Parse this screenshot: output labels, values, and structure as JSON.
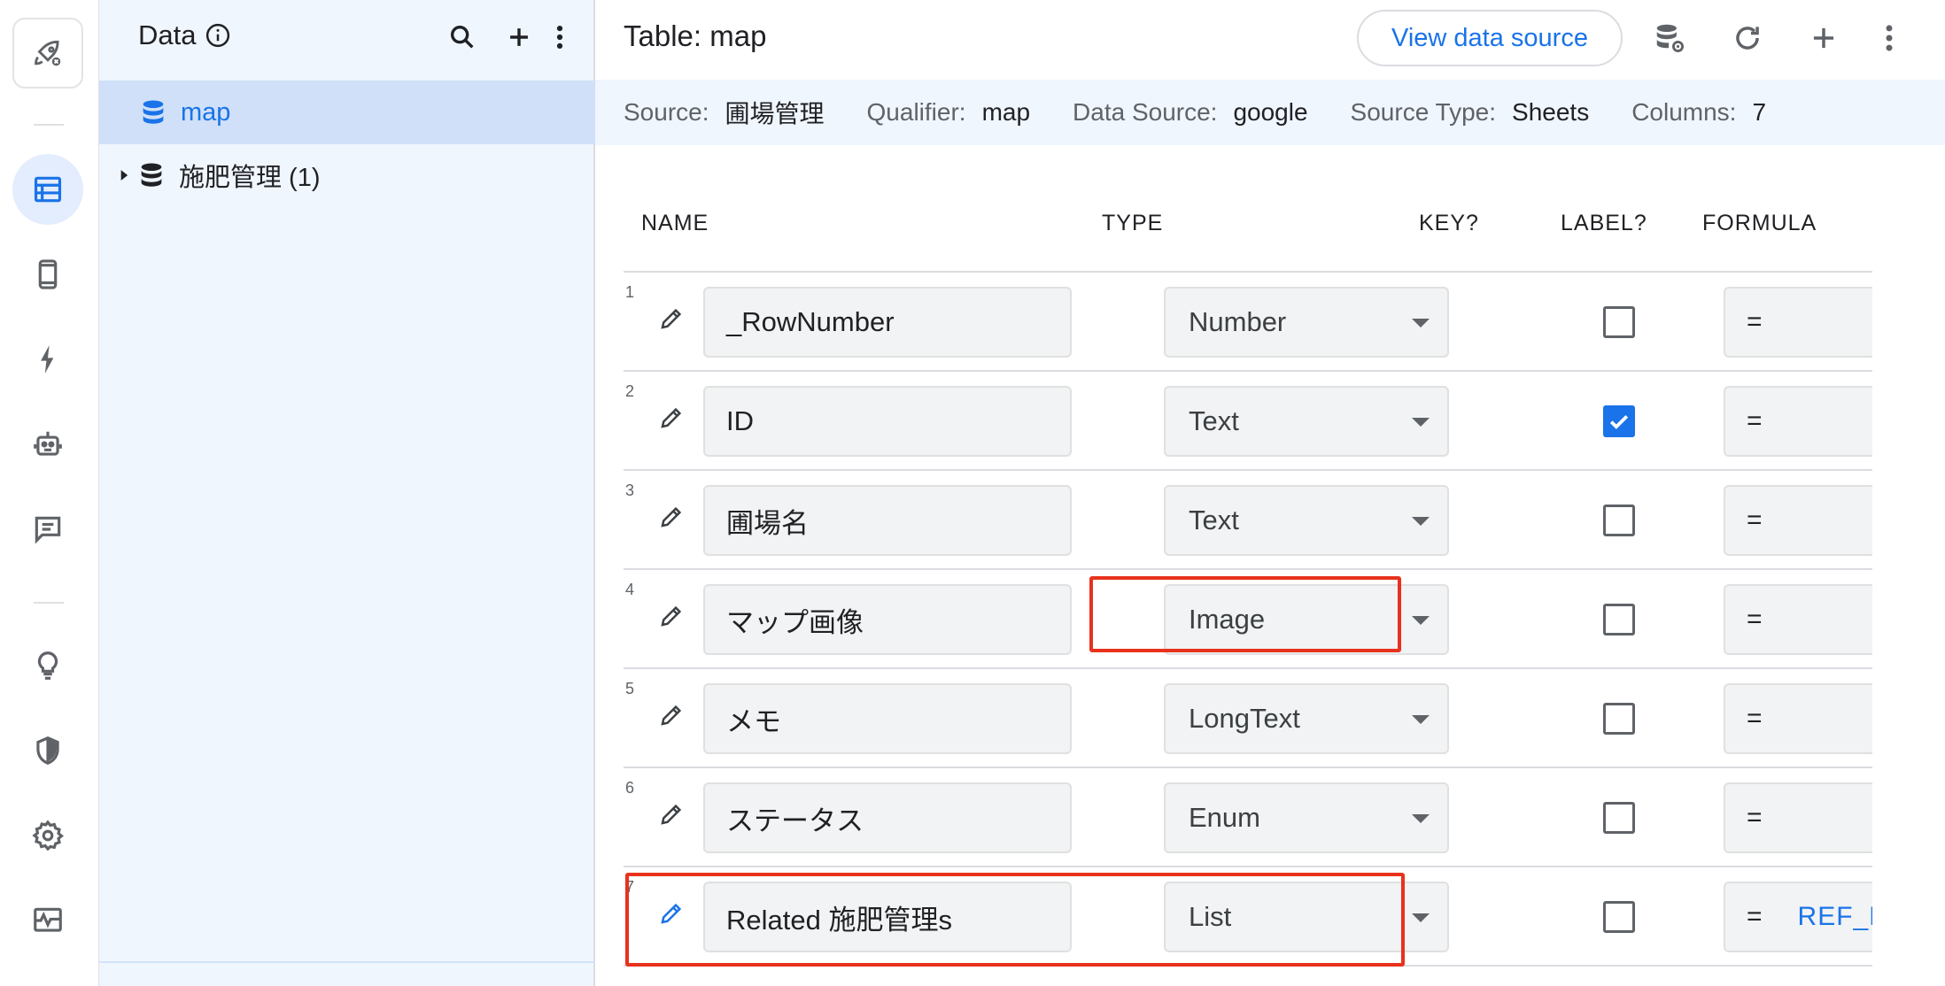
{
  "data_panel": {
    "title": "Data",
    "tables": [
      {
        "label": "map",
        "selected": true
      },
      {
        "label": "施肥管理 (1)",
        "selected": false
      }
    ]
  },
  "header": {
    "title": "Table: map",
    "view_source_label": "View data source"
  },
  "info": {
    "source_label": "Source:",
    "source_value": "圃場管理",
    "qualifier_label": "Qualifier:",
    "qualifier_value": "map",
    "data_source_label": "Data Source:",
    "data_source_value": "google",
    "source_type_label": "Source Type:",
    "source_type_value": "Sheets",
    "columns_label": "Columns:",
    "columns_value": "7"
  },
  "columns": {
    "name": "NAME",
    "type": "TYPE",
    "key": "KEY?",
    "label": "LABEL?",
    "formula": "FORMULA"
  },
  "rows": [
    {
      "num": "1",
      "name": "_RowNumber",
      "type": "Number",
      "key": false,
      "label": false,
      "formula": "=",
      "formula_ref": ""
    },
    {
      "num": "2",
      "name": "ID",
      "type": "Text",
      "key": true,
      "label": false,
      "formula": "=",
      "formula_ref": ""
    },
    {
      "num": "3",
      "name": "圃場名",
      "type": "Text",
      "key": false,
      "label": true,
      "formula": "=",
      "formula_ref": ""
    },
    {
      "num": "4",
      "name": "マップ画像",
      "type": "Image",
      "key": false,
      "label": false,
      "formula": "=",
      "formula_ref": ""
    },
    {
      "num": "5",
      "name": "メモ",
      "type": "LongText",
      "key": false,
      "label": false,
      "formula": "=",
      "formula_ref": ""
    },
    {
      "num": "6",
      "name": "ステータス",
      "type": "Enum",
      "key": false,
      "label": false,
      "formula": "=",
      "formula_ref": ""
    },
    {
      "num": "7",
      "name": "Related 施肥管理s",
      "type": "List",
      "key": false,
      "label": false,
      "formula": "=",
      "formula_ref": "REF_R"
    }
  ],
  "colors": {
    "accent": "#1a73e8",
    "highlight": "#e8321d",
    "panel_bg": "#f0f6fe",
    "selected_bg": "#cfe0f8"
  }
}
